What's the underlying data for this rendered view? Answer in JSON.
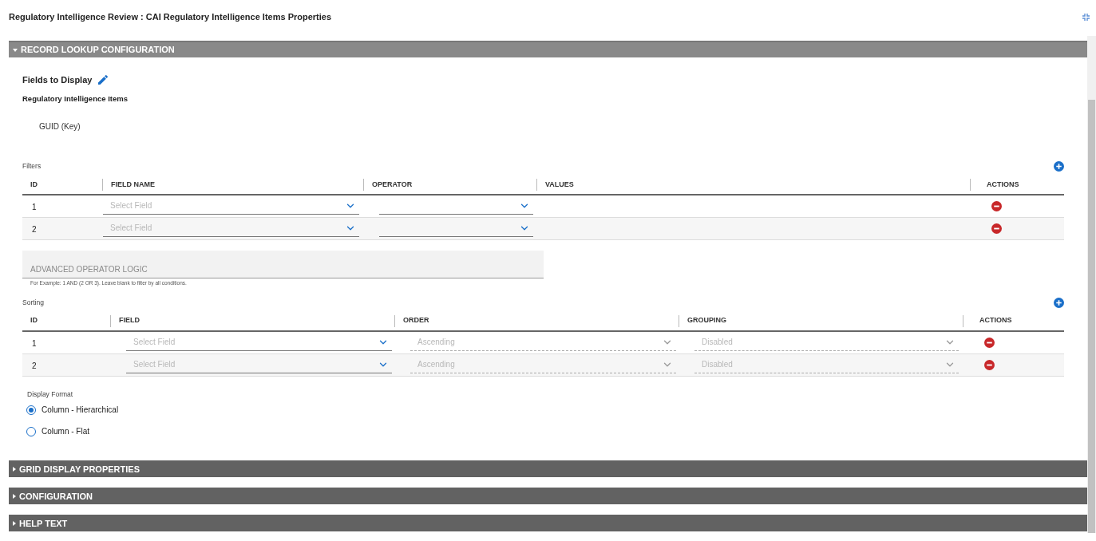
{
  "window": {
    "title": "Regulatory Intelligence Review : CAI Regulatory Intelligence Items Properties"
  },
  "sections": [
    {
      "title": "RECORD LOOKUP CONFIGURATION",
      "expanded": true
    },
    {
      "title": "GRID DISPLAY PROPERTIES",
      "expanded": false
    },
    {
      "title": "CONFIGURATION",
      "expanded": false
    },
    {
      "title": "HELP TEXT",
      "expanded": false
    }
  ],
  "record_lookup": {
    "fields_to_display": {
      "heading": "Fields to Display",
      "object": "Regulatory Intelligence Items",
      "fields": [
        "GUID (Key)"
      ]
    },
    "filters": {
      "label": "Filters",
      "columns": [
        "ID",
        "FIELD NAME",
        "OPERATOR",
        "VALUES",
        "ACTIONS"
      ],
      "rows": [
        {
          "id": "1",
          "field": {
            "placeholder": "Select Field"
          }
        },
        {
          "id": "2",
          "field": {
            "placeholder": "Select Field"
          }
        }
      ]
    },
    "advanced_logic": {
      "placeholder": "ADVANCED OPERATOR LOGIC",
      "hint": "For Example: 1 AND (2 OR 3). Leave blank to filter by all conditions."
    },
    "sorting": {
      "label": "Sorting",
      "columns": [
        "ID",
        "FIELD",
        "ORDER",
        "GROUPING",
        "ACTIONS"
      ],
      "rows": [
        {
          "id": "1",
          "field": {
            "placeholder": "Select Field"
          },
          "order": {
            "value": "Ascending",
            "disabled": true
          },
          "grouping": {
            "value": "Disabled",
            "disabled": true
          }
        },
        {
          "id": "2",
          "field": {
            "placeholder": "Select Field"
          },
          "order": {
            "value": "Ascending",
            "disabled": true
          },
          "grouping": {
            "value": "Disabled",
            "disabled": true
          }
        }
      ]
    },
    "display_format": {
      "label": "Display Format",
      "options": [
        {
          "label": "Column - Hierarchical",
          "selected": true
        },
        {
          "label": "Column - Flat",
          "selected": false
        }
      ]
    }
  }
}
